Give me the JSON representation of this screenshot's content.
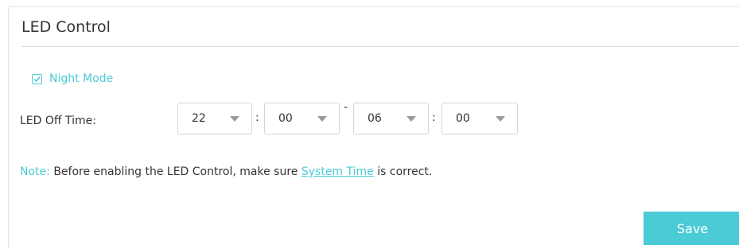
{
  "panel": {
    "title": "LED Control"
  },
  "night_mode": {
    "label": "Night Mode",
    "checked": true,
    "icon": "check-icon"
  },
  "led_off_time": {
    "label": "LED Off Time:",
    "start_hour": "22",
    "start_minute": "00",
    "end_hour": "06",
    "end_minute": "00",
    "time_separator": ":",
    "range_separator": "-"
  },
  "note": {
    "prefix": "Note:",
    "before_link": "Before enabling the LED Control, make sure",
    "link_text": "System Time",
    "after_link": "is correct."
  },
  "buttons": {
    "save_label": "Save"
  },
  "colors": {
    "accent": "#4acbd6",
    "text": "#333333",
    "border": "#d6d6d6"
  }
}
